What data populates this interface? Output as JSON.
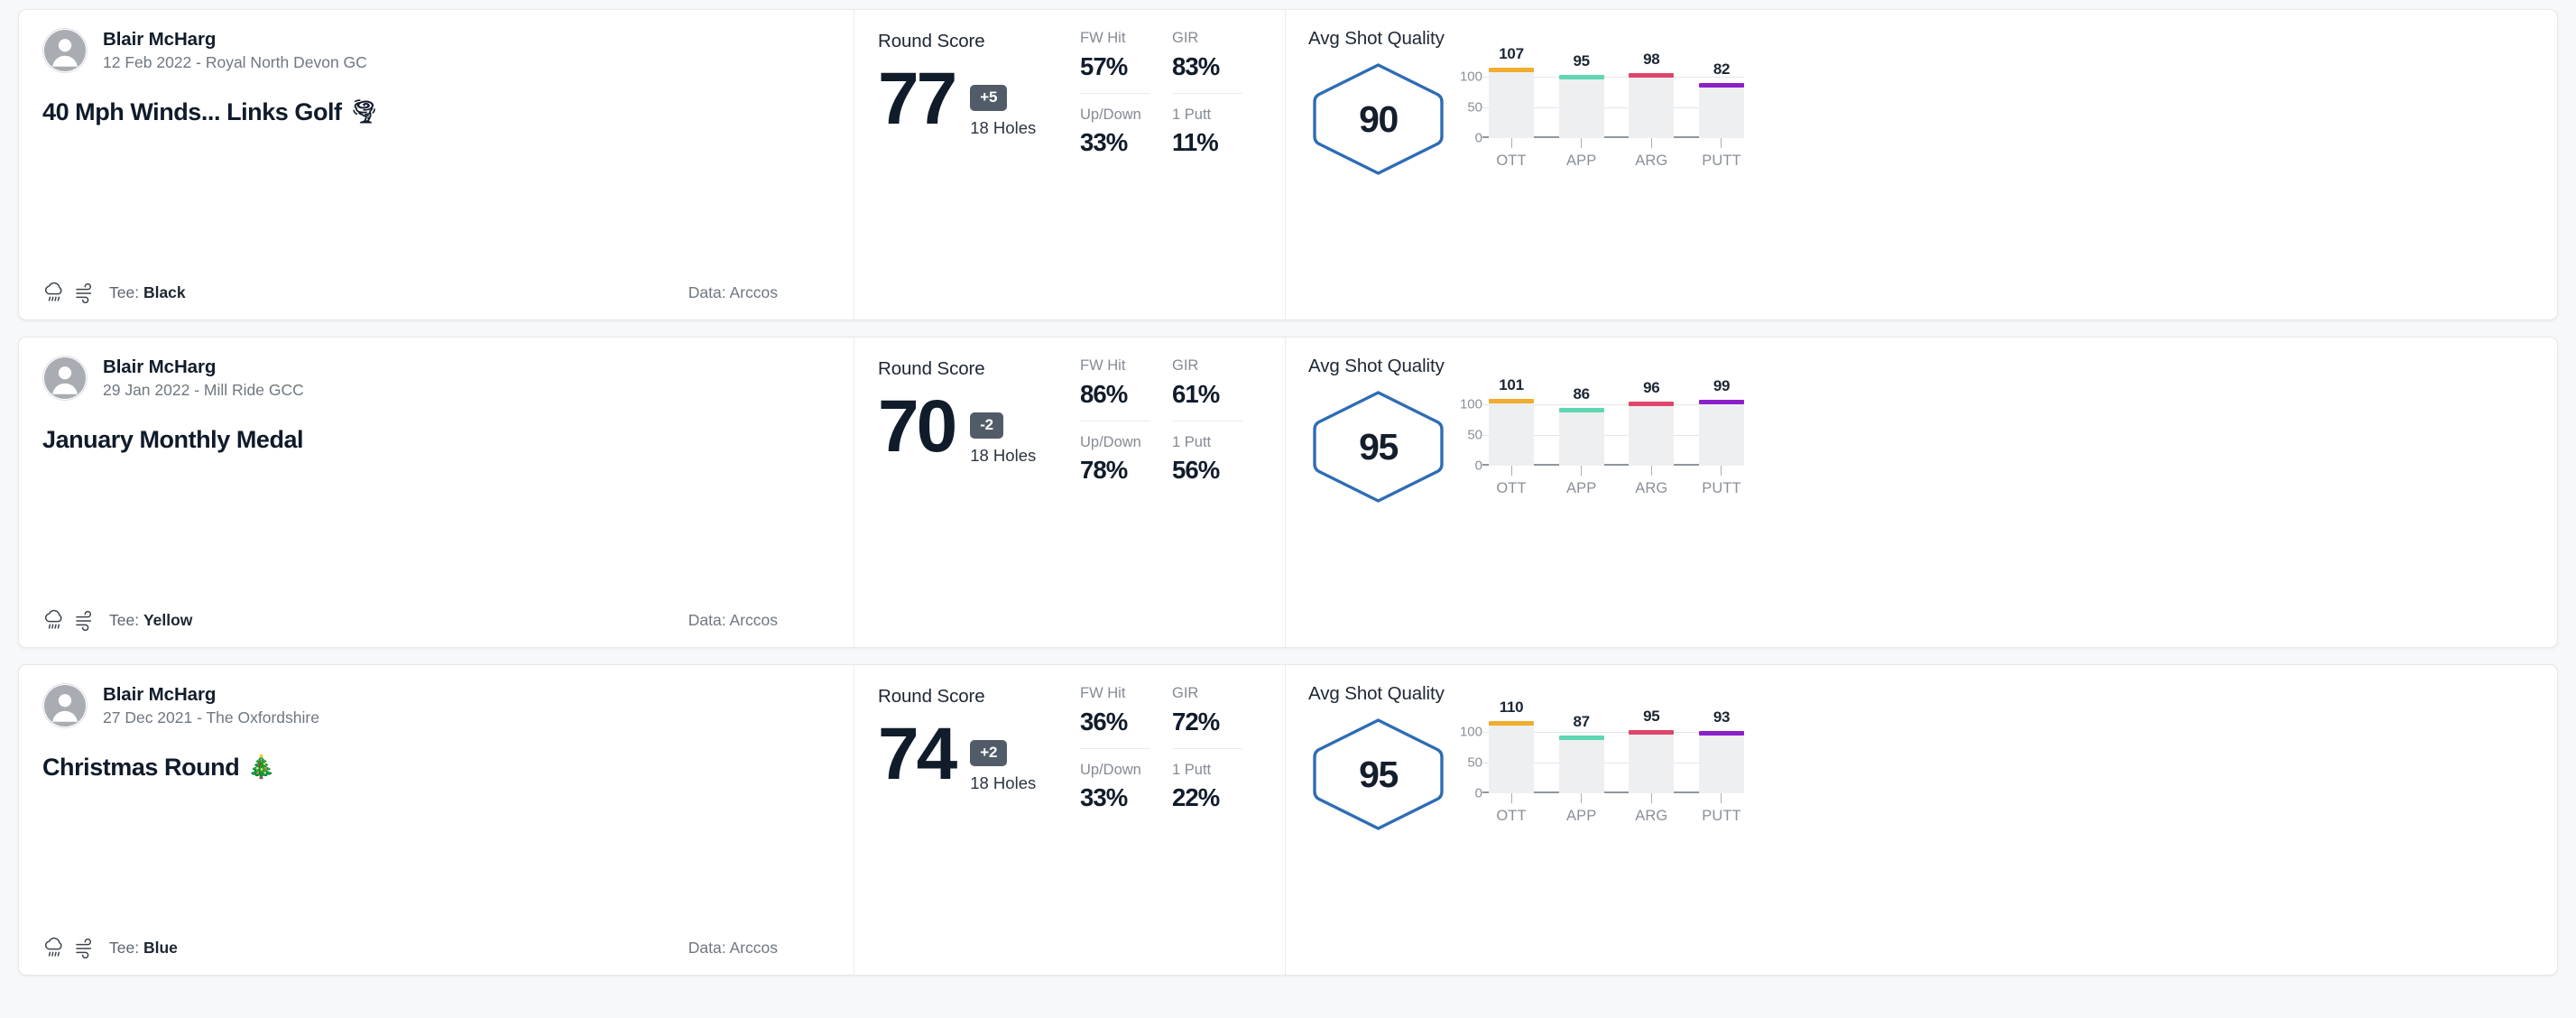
{
  "labels": {
    "round_score": "Round Score",
    "holes": "18 Holes",
    "avg_shot_quality": "Avg Shot Quality",
    "tee_prefix": "Tee:",
    "stat_fw": "FW Hit",
    "stat_gir": "GIR",
    "stat_updown": "Up/Down",
    "stat_1putt": "1 Putt"
  },
  "colors": {
    "hexagon_stroke": "#2e6db4",
    "badge_bg": "#525c68",
    "bar_track": "#eeeff0",
    "ott": "#f0ad2e",
    "app": "#5fd6b4",
    "arg": "#e0456b",
    "putt": "#8b1fc9",
    "score_text": "#101c2a"
  },
  "rounds": [
    {
      "user": "Blair McHarg",
      "date_course": "12 Feb 2022 - Royal North Devon GC",
      "title": "40 Mph Winds... Links Golf",
      "title_emoji": "🌪",
      "weather_icon": "rain-cloud-icon",
      "wind_icon": "wind-icon",
      "tee": "Black",
      "data_source": "Data: Arccos",
      "score": "77",
      "to_par": "+5",
      "holes": "18 Holes",
      "stats": [
        {
          "name": "FW Hit",
          "value": "57%"
        },
        {
          "name": "GIR",
          "value": "83%"
        },
        {
          "name": "Up/Down",
          "value": "33%"
        },
        {
          "name": "1 Putt",
          "value": "11%"
        }
      ],
      "avg_shot_quality": "90",
      "chart_data": {
        "type": "bar",
        "title": "Avg Shot Quality",
        "categories": [
          "OTT",
          "APP",
          "ARG",
          "PUTT"
        ],
        "values": [
          107,
          95,
          98,
          82
        ],
        "series": [
          {
            "name": "OTT",
            "value": 107,
            "color": "#f0ad2e"
          },
          {
            "name": "APP",
            "value": 95,
            "color": "#5fd6b4"
          },
          {
            "name": "ARG",
            "value": 98,
            "color": "#e0456b"
          },
          {
            "name": "PUTT",
            "value": 82,
            "color": "#8b1fc9"
          }
        ],
        "yticks": [
          100,
          50,
          0
        ],
        "ylim": [
          0,
          120
        ],
        "xlabel": "",
        "ylabel": "",
        "grid": true,
        "legend": "none"
      }
    },
    {
      "user": "Blair McHarg",
      "date_course": "29 Jan 2022 - Mill Ride GCC",
      "title": "January Monthly Medal",
      "title_emoji": "",
      "weather_icon": "rain-cloud-icon",
      "wind_icon": "wind-icon",
      "tee": "Yellow",
      "data_source": "Data: Arccos",
      "score": "70",
      "to_par": "-2",
      "holes": "18 Holes",
      "stats": [
        {
          "name": "FW Hit",
          "value": "86%"
        },
        {
          "name": "GIR",
          "value": "61%"
        },
        {
          "name": "Up/Down",
          "value": "78%"
        },
        {
          "name": "1 Putt",
          "value": "56%"
        }
      ],
      "avg_shot_quality": "95",
      "chart_data": {
        "type": "bar",
        "title": "Avg Shot Quality",
        "categories": [
          "OTT",
          "APP",
          "ARG",
          "PUTT"
        ],
        "values": [
          101,
          86,
          96,
          99
        ],
        "series": [
          {
            "name": "OTT",
            "value": 101,
            "color": "#f0ad2e"
          },
          {
            "name": "APP",
            "value": 86,
            "color": "#5fd6b4"
          },
          {
            "name": "ARG",
            "value": 96,
            "color": "#e0456b"
          },
          {
            "name": "PUTT",
            "value": 99,
            "color": "#8b1fc9"
          }
        ],
        "yticks": [
          100,
          50,
          0
        ],
        "ylim": [
          0,
          120
        ],
        "xlabel": "",
        "ylabel": "",
        "grid": true,
        "legend": "none"
      }
    },
    {
      "user": "Blair McHarg",
      "date_course": "27 Dec 2021 - The Oxfordshire",
      "title": "Christmas Round",
      "title_emoji": "🎄",
      "weather_icon": "rain-cloud-icon",
      "wind_icon": "wind-icon",
      "tee": "Blue",
      "data_source": "Data: Arccos",
      "score": "74",
      "to_par": "+2",
      "holes": "18 Holes",
      "stats": [
        {
          "name": "FW Hit",
          "value": "36%"
        },
        {
          "name": "GIR",
          "value": "72%"
        },
        {
          "name": "Up/Down",
          "value": "33%"
        },
        {
          "name": "1 Putt",
          "value": "22%"
        }
      ],
      "avg_shot_quality": "95",
      "chart_data": {
        "type": "bar",
        "title": "Avg Shot Quality",
        "categories": [
          "OTT",
          "APP",
          "ARG",
          "PUTT"
        ],
        "values": [
          110,
          87,
          95,
          93
        ],
        "series": [
          {
            "name": "OTT",
            "value": 110,
            "color": "#f0ad2e"
          },
          {
            "name": "APP",
            "value": 87,
            "color": "#5fd6b4"
          },
          {
            "name": "ARG",
            "value": 95,
            "color": "#e0456b"
          },
          {
            "name": "PUTT",
            "value": 93,
            "color": "#8b1fc9"
          }
        ],
        "yticks": [
          100,
          50,
          0
        ],
        "ylim": [
          0,
          120
        ],
        "xlabel": "",
        "ylabel": "",
        "grid": true,
        "legend": "none"
      }
    }
  ]
}
